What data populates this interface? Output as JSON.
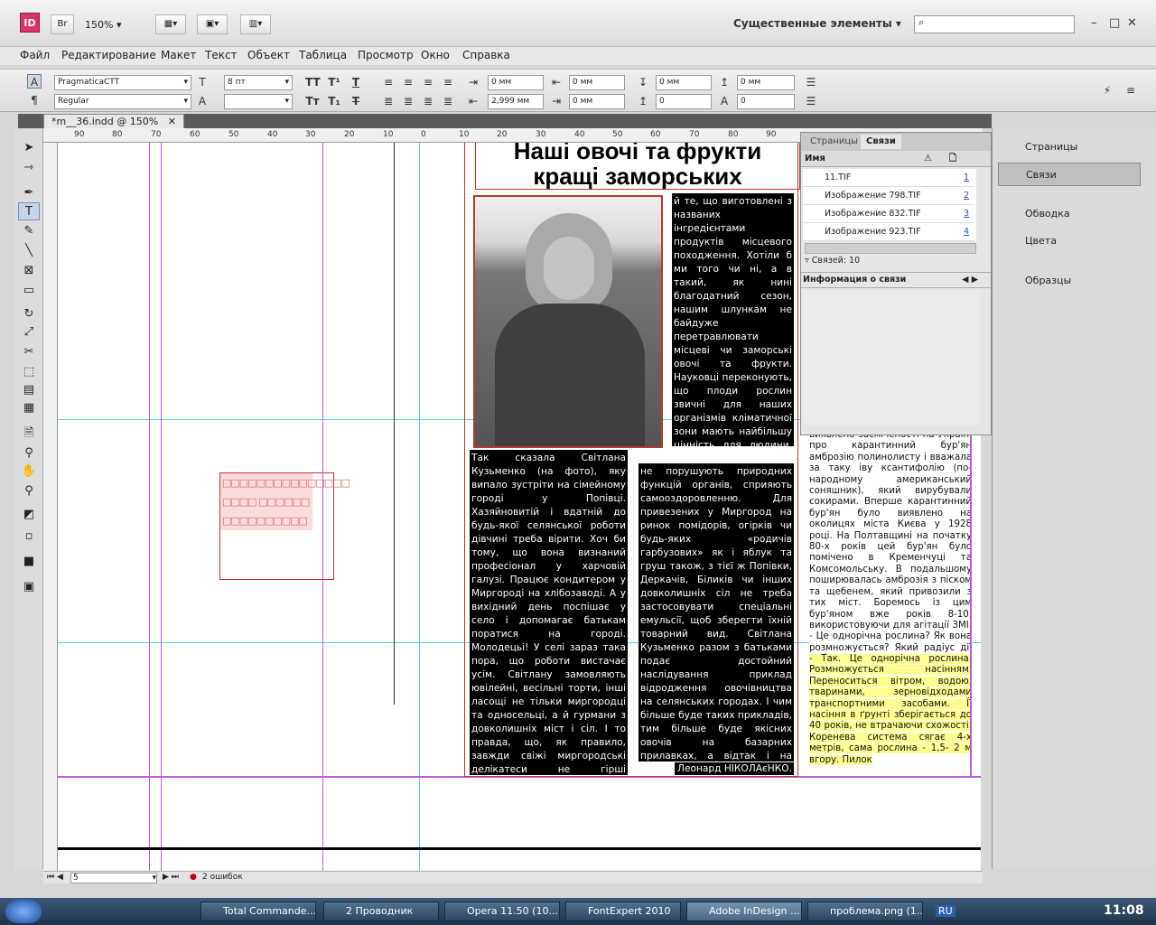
{
  "app": {
    "icon": "ID",
    "bridge": "Br",
    "zoom": "150%",
    "workspace": "Существенные элементы"
  },
  "menu": [
    "Файл",
    "Редактирование",
    "Макет",
    "Текст",
    "Объект",
    "Таблица",
    "Просмотр",
    "Окно",
    "Справка"
  ],
  "control": {
    "font": "PragmaticaCTT",
    "style": "Regular",
    "size": "8 пт",
    "leading": "",
    "indent_left": "0 мм",
    "indent_first": "2,999 мм",
    "indent_right": "0 мм",
    "indent_last": "0 мм",
    "space_before": "0 мм",
    "space_after": "0",
    "space_above": "0 мм",
    "space_below": "0"
  },
  "doc_tab": "*m__36.indd @ 150%",
  "ruler_labels": [
    "90",
    "80",
    "70",
    "60",
    "50",
    "40",
    "30",
    "20",
    "10",
    "0",
    "10",
    "20",
    "30",
    "40",
    "50",
    "60",
    "70",
    "80",
    "90"
  ],
  "article": {
    "headline_1": "Наші овочі та фрукти",
    "headline_2": "кращі заморських",
    "col_right_top": "й те, що виготовлені з названих інгредієнтами продуктів місцевого походження. Хотіли б ми того чи ні, а в такий, як нині благодатний сезон, нашим шлункам не байдуже перетравлювати місцеві чи заморські овочі та фрукти. Науковці переконують, що плоди рослин звичні для наших організмів кліматичної зони мають найбільшу цінність для людини. Місцеві овочі та фрукти краще засвоюються,",
    "col_left": "Так сказала Світлана Кузьменко (на фото), яку випало зустріти на сімейному городі у Попівці. Хазяйновитій і вдатній до будь-якої селянської роботи дівчині треба вірити. Хоч би тому, що вона визнаний професіонал у харчовій галузі. Працює кондитером у Миргороді на хлібозаводі. А у вихідний день поспішає у село і допомагає батькам поратися на городі. Молодецьі! У селі зараз така пора, що роботи вистачає усім. Світлану замовляють ювілейні, весільні торти, інші ласощі не тільки миргородці та односельці, а й гурмани з довколишніх міст і сіл. І то правда, що, як правило, завжди свіжі миргородські делікатеси не гірші привезених з столиці чи бо-знає звідки. Їх перевагою є",
    "col_mid": "не порушують природних функцій органів, сприяють самооздоровленню. Для привезених у Миргород на ринок помідорів, огірків чи будь-яких «родичів гарбузових» як і яблук та груш також, з тієї ж Попівки, Деркачів, Біликів чи інших довколишніх сіл не треба застосовувати спеціальні емульсії, щоб зберегти їхній товарний вид. Світлана Кузьменко разом з батьками подає достойний наслідування приклад відродження овочівництва на селянських городах. І чим більше буде таких прикладів, тим більше буде якісних овочів на базарних прилавках, а відтак і на обідніх столах миргородців.",
    "signature": "Леонард НІКОЛАєНКО.",
    "col_far": "виявлено засміченості на Україні про карантинний бур'ян амброзію полинолисту і вважала за таку іву ксантифолію (по-народному американський соняшник), який вирубували сокирами. Вперше карантинний бур'ян було виявлено на околицях міста Києва у 1928 році. На Полтавщині на початку 80-х років цей бур'ян було помічено в Кременчуці та Комсомольську. В подальшому поширювалась амброзія з піском та щебенем, який привозили з тих міст. Боремось із цим бур'яном вже років 8-10, використовуючи для агітації ЗМІ. - Це однорічна рослина? Як вона розмножується? Який радіус дії амброзії? Це правда, що пилок може поширюватись на кілька кілометрів?",
    "col_far_highlight": "- Так. Це однорічна рослина. Розмножується насінням. Переноситься вітром, водою, тваринами, зерновідходами транспортними засобами. Її насіння в ґрунті зберігається до 40 років, не втрачаючи схожості. Коренева система сягає 4-х метрів, сама рослина - 1,5- 2 м вгору. Пилок",
    "placeholder_text": "□□□□□□□□□□□□□□□ □□□□ □□□□□□ □□□□□□□□□□"
  },
  "links_panel": {
    "tabs": [
      "Страницы",
      "Связи"
    ],
    "col_name": "Имя",
    "rows": [
      {
        "name": "11.TIF",
        "page": "1"
      },
      {
        "name": "Изображение 798.TIF",
        "page": "2"
      },
      {
        "name": "Изображение 832.TIF",
        "page": "3"
      },
      {
        "name": "Изображение 923.TIF",
        "page": "4"
      }
    ],
    "count": "Связей: 10",
    "info_title": "Информация о связи"
  },
  "dock": [
    "Страницы",
    "Связи",
    "Обводка",
    "Цвета",
    "Образцы"
  ],
  "status": {
    "page": "5",
    "errors": "2 ошибок"
  },
  "taskbar": [
    "Total Commande...",
    "2 Проводник",
    "Opera 11.50 (10...",
    "FontExpert 2010",
    "Adobe InDesign ...",
    "проблема.png (1..."
  ],
  "tray": {
    "lang": "RU",
    "time": "11:08"
  },
  "colors": {
    "guide_cyan": "#49d6dc",
    "guide_magenta": "#c058d8",
    "frame_red": "#c0312c",
    "highlight": "#ffff90"
  }
}
